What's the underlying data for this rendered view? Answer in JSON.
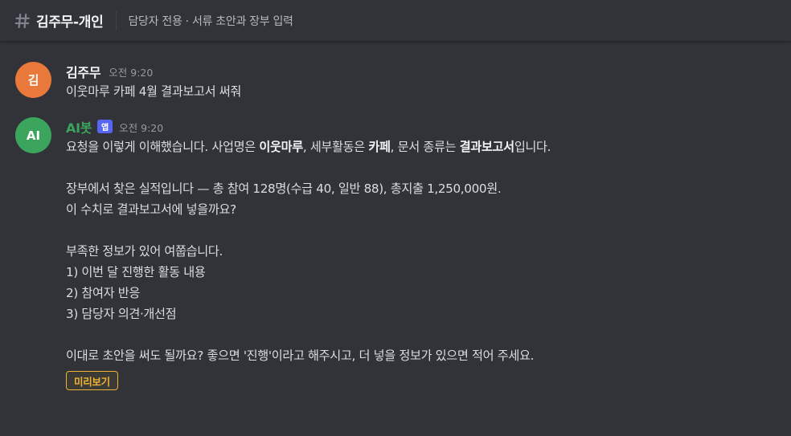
{
  "channel": {
    "name": "김주무-개인",
    "topic": "담당자 전용 · 서류 초안과 장부 입력"
  },
  "colors": {
    "user_avatar": "#e8793a",
    "bot_avatar": "#3ba55d",
    "bot_name": "#3ba55d",
    "app_badge": "#5865f2",
    "preview_button": "#f0b232"
  },
  "messages": [
    {
      "avatar_text": "김",
      "author": "김주무",
      "timestamp": "오전 9:20",
      "lines": [
        "이웃마루 카페 4월 결과보고서 써줘"
      ]
    },
    {
      "avatar_text": "AI",
      "author": "AI봇",
      "badge": "앱",
      "timestamp": "오전 9:20",
      "line1": {
        "a": "요청을 이렇게 이해했습니다. 사업명은 ",
        "b": "이웃마루",
        "c": ", 세부활동은 ",
        "d": "카페",
        "e": ", 문서 종류는 ",
        "f": "결과보고서",
        "g": "입니다."
      },
      "lines": [
        "장부에서 찾은 실적입니다 — 총 참여 128명(수급 40, 일반 88), 총지출 1,250,000원.",
        "이 수치로 결과보고서에 넣을까요?",
        "부족한 정보가 있어 여쭙습니다.",
        "1) 이번 달 진행한 활동 내용",
        "2) 참여자 반응",
        "3) 담당자 의견·개선점",
        "이대로 초안을 써도 될까요? 좋으면 '진행'이라고 해주시고, 더 넣을 정보가 있으면 적어 주세요."
      ],
      "button_label": "미리보기"
    }
  ]
}
